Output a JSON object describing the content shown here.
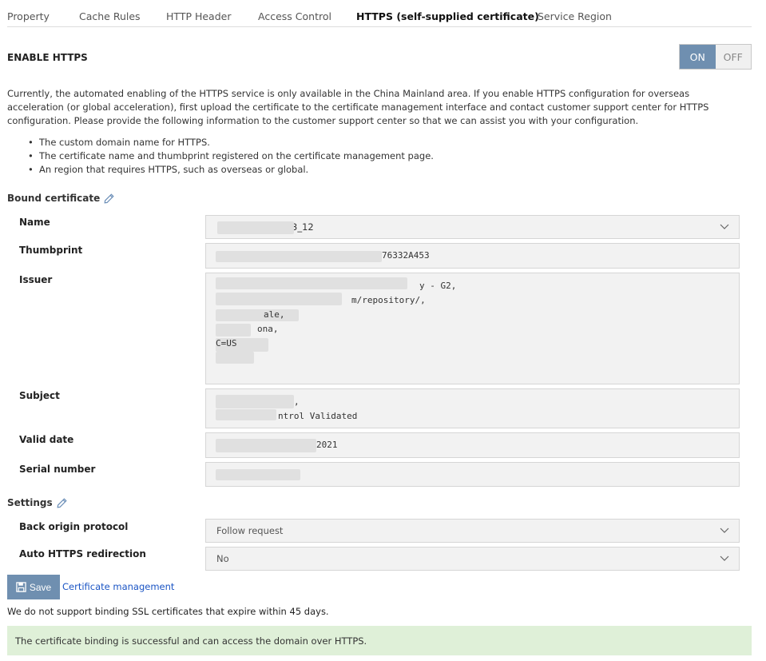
{
  "tabs": [
    {
      "label": "Property"
    },
    {
      "label": "Cache Rules"
    },
    {
      "label": "HTTP Header"
    },
    {
      "label": "Access Control"
    },
    {
      "label": "HTTPS (self-supplied certificate)"
    },
    {
      "label": "Service Region"
    }
  ],
  "active_tab": "HTTPS (self-supplied certificate)",
  "enable_https": {
    "title": "ENABLE HTTPS",
    "on_label": "ON",
    "off_label": "OFF",
    "state": "ON"
  },
  "notice": "Currently, the automated enabling of the HTTPS service is only available in the China Mainland area. If you enable HTTPS configuration for overseas acceleration (or global acceleration), first upload the certificate to the certificate management interface and contact customer support center for HTTPS configuration. Please provide the following information to the customer support center so that we can assist you with your configuration.",
  "bullets": [
    "The custom domain name for HTTPS.",
    "The certificate name and thumbprint registered on the certificate management page.",
    "An region that requires HTTPS, such as overseas or global."
  ],
  "bound_certificate": {
    "title": "Bound certificate",
    "name_label": "Name",
    "name_value": "3_12",
    "thumbprint_label": "Thumbprint",
    "thumbprint_value": "76332A453",
    "issuer_label": "Issuer",
    "issuer_lines": [
      "y - G2,",
      "m/repository/,",
      "",
      "",
      "ale,",
      "ona,",
      "C=US"
    ],
    "subject_label": "Subject",
    "subject_lines": [
      ",",
      "ntrol Validated"
    ],
    "valid_date_label": "Valid date",
    "valid_date_value": "2021",
    "serial_label": "Serial number",
    "serial_value": ""
  },
  "settings": {
    "title": "Settings",
    "back_origin_label": "Back origin protocol",
    "back_origin_value": "Follow request",
    "auto_redirect_label": "Auto HTTPS redirection",
    "auto_redirect_value": "No"
  },
  "actions": {
    "save_label": "Save",
    "cert_link_label": "Certificate management"
  },
  "warning": "We do not support binding SSL certificates that expire within 45 days.",
  "success_message": "The certificate binding is successful and can access the domain over HTTPS.",
  "colors": {
    "accent": "#6f8fb0",
    "link": "#1a54c4",
    "success_bg": "#dff0d8"
  }
}
